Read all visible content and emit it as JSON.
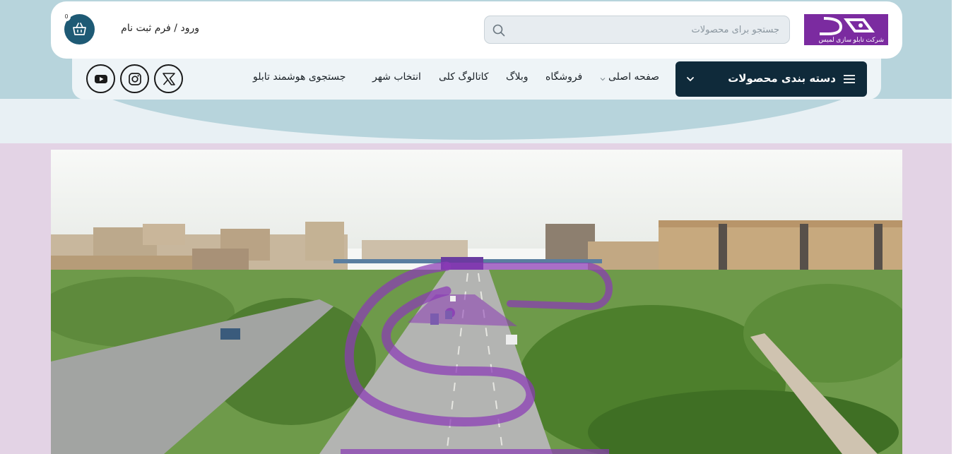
{
  "brand": {
    "logo_text": "شرکت تابلو سازی لمیس",
    "accent_purple": "#7b2ba0",
    "dark_navy": "#0f2a3a",
    "teal": "#1e5a75"
  },
  "header": {
    "search_placeholder": "جستجو برای محصولات",
    "login_label": "ورود / فرم ثبت نام",
    "cart_count": "0"
  },
  "nav": {
    "categories_label": "دسته بندی محصولات",
    "items": [
      {
        "label": "صفحه اصلی"
      },
      {
        "label": "فروشگاه"
      },
      {
        "label": "وبلاگ"
      },
      {
        "label": "کاتالوگ کلی"
      },
      {
        "label": "انتخاب شهر"
      },
      {
        "label": "جستجوی هوشمند تابلو"
      }
    ]
  },
  "social": [
    {
      "icon": "x-icon"
    },
    {
      "icon": "instagram-icon"
    },
    {
      "icon": "youtube-icon"
    }
  ],
  "hero": {
    "image": "aerial-city-boulevard"
  }
}
